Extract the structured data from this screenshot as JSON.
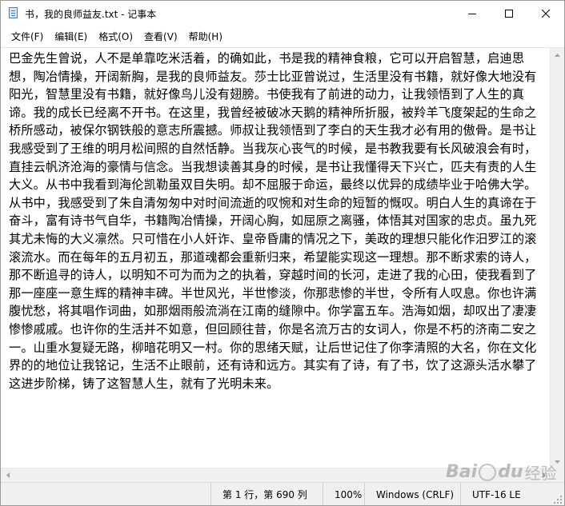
{
  "window": {
    "title": "书，我的良师益友.txt - 记事本"
  },
  "menu": {
    "items": [
      "文件(F)",
      "编辑(E)",
      "格式(O)",
      "查看(V)",
      "帮助(H)"
    ]
  },
  "editor": {
    "text": "巴金先生曾说，人不是单靠吃米活着，的确如此，书是我的精神食粮，它可以开启智慧，启迪思想，陶冶情操，开阔新胸，是我的良师益友。莎士比亚曾说过，生活里没有书籍，就好像大地没有阳光，智慧里没有书籍，就好像鸟儿没有翅膀。书使我有了前进的动力，让我领悟到了人生的真谛。我的成长已经离不开书。在这里，我曾经被破冰天鹅的精神所折服，被羚羊飞度架起的生命之桥所感动，被保尔钢铁般的意志所震撼。师叔让我领悟到了李白的天生我才必有用的傲骨。是书让我感受到了王维的明月松间照的自然恬静。当我灰心丧气的时候，是书教我要有长风破浪会有时，直挂云帆济沧海的豪情与信念。当我想读善其身的时候，是书让我懂得天下兴亡，匹夫有责的人生大义。从书中我看到海伦凯勒虽双目失明。却不屈服于命运，最终以优异的成绩毕业于哈佛大学。从书中，我感受到了朱自清匆匆中对时间流逝的叹惋和对生命的短暂的慨叹。明白人生的真谛在于奋斗，富有诗书气自华，书籍陶冶情操，开阔心胸，如屈原之离骚，体悟其对国家的忠贞。虽九死其尤未悔的大义凛然。只可惜在小人奸诈、皇帝昏庸的情况之下，美政的理想只能化作汨罗江的滚滚流水。而在每年的五月初五，那道魂都会重新归来，希望能实现这一理想。那不断求索的诗人，那不断追寻的诗人，以明知不可为而为之的执着，穿越时间的长河，走进了我的心田，使我看到了那一座座一意生辉的精神丰碑。半世风光，半世惨淡，你那悲惨的半世，令所有人叹息。你也许满腹忧愁，将其唱作词曲，如那烟雨般流淌在江南的缝隙中。你学富五车。浩海如烟，却叹出了凄凄惨惨戚戚。也许你的生活并不如意，但回顾往昔，你是名流万古的女词人，你是不朽的济南二安之一。山重水复疑无路，柳暗花明又一村。你的思绪天赋，让后世记住了你李清照的大名，你在文化界的的地位让我铭记，生活不止眼前，还有诗和远方。其实有了诗，有了书，饮了这源头活水攀了这进步阶梯，铸了这智慧人生，就有了光明未来。"
  },
  "statusbar": {
    "position": "第 1 行，第 690 列",
    "zoom": "100%",
    "line_ending": "Windows (CRLF)",
    "encoding": "UTF-16 LE"
  },
  "watermark": {
    "brand": "Bai",
    "brand_suffix": "du",
    "label": "经验"
  },
  "icons": [
    "notepad-app-icon",
    "minimize-icon",
    "maximize-icon",
    "close-icon",
    "scroll-up-icon",
    "scroll-down-icon",
    "scroll-left-icon",
    "scroll-right-icon",
    "resize-grip-icon"
  ]
}
